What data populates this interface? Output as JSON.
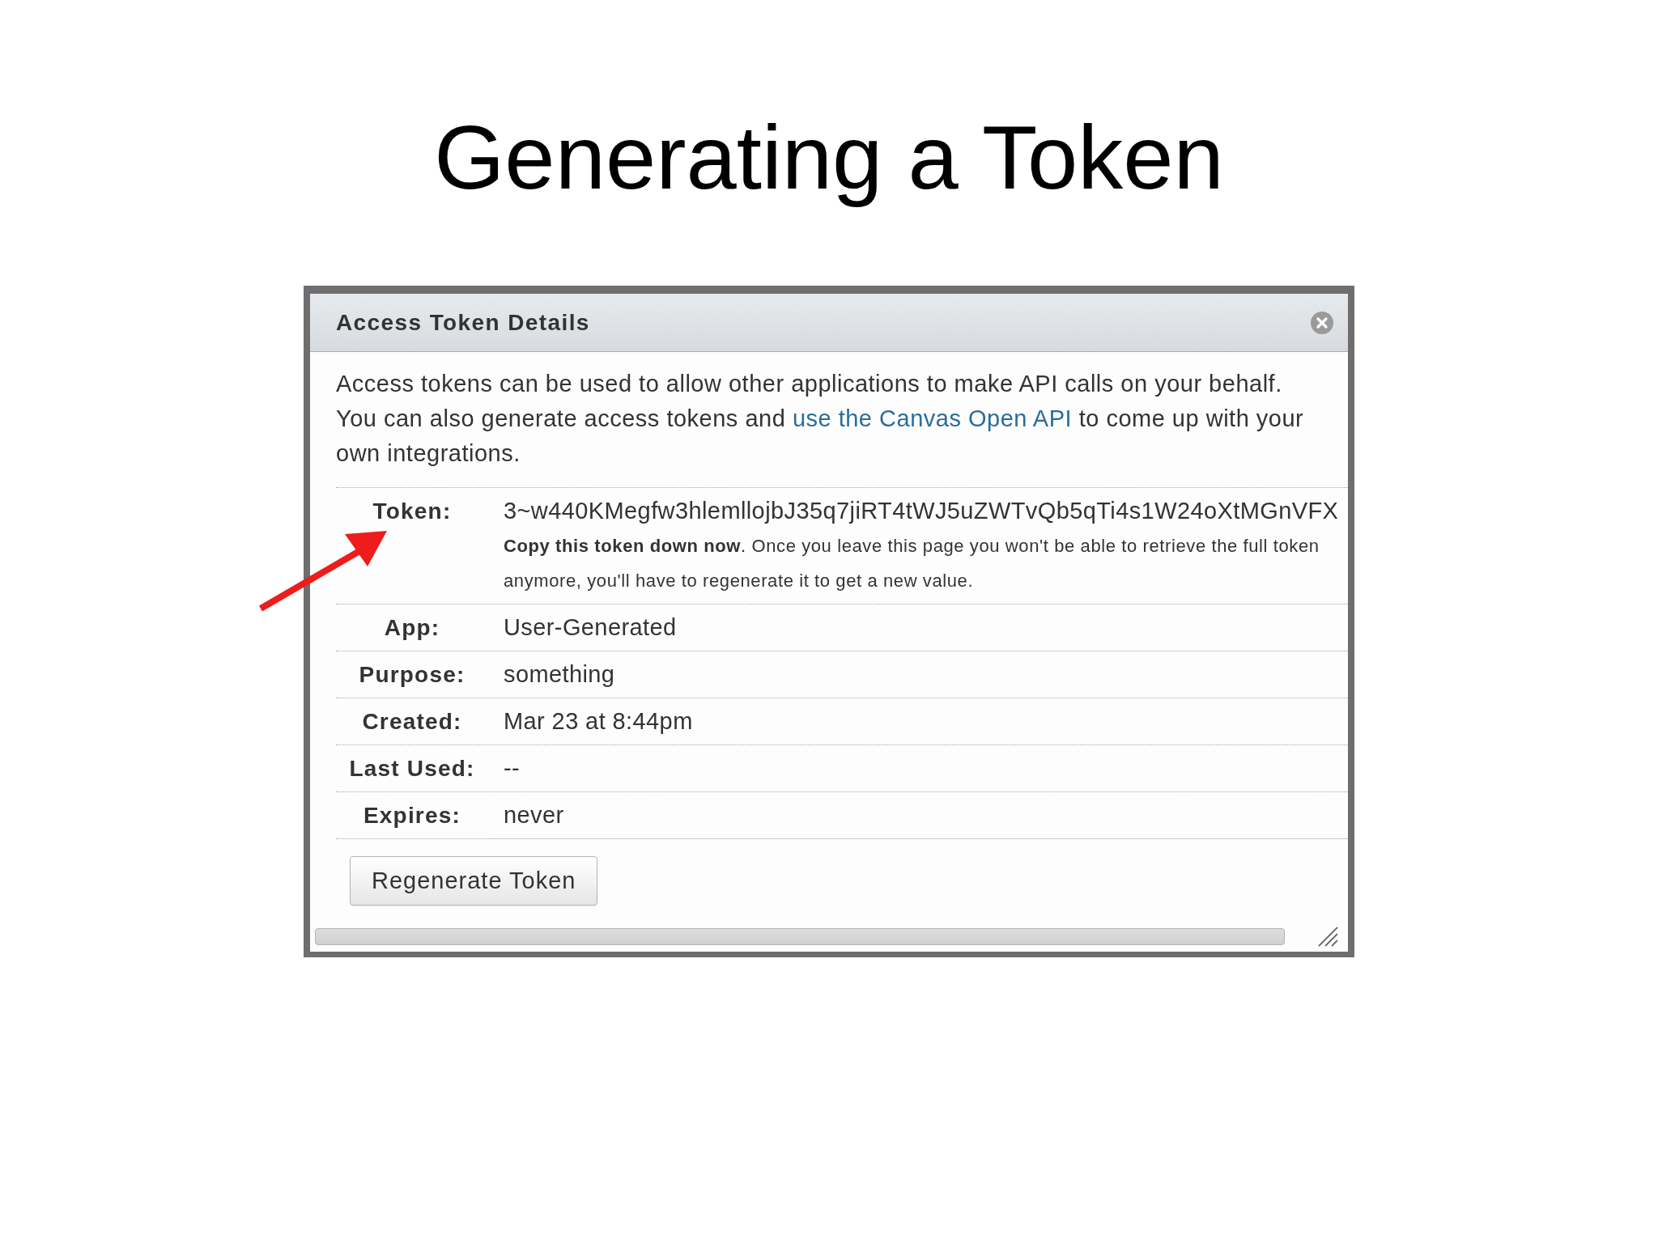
{
  "slide": {
    "title": "Generating a Token"
  },
  "dialog": {
    "title": "Access Token Details",
    "intro": [
      [
        {
          "kind": "text",
          "text": "Access tokens can be used to allow other applications to make API calls on your behalf."
        }
      ],
      [
        {
          "kind": "text",
          "text": "You can also generate access tokens and"
        },
        {
          "kind": "link",
          "text": "use the Canvas Open API"
        },
        {
          "kind": "text",
          "text": "to come up with your own integrations."
        }
      ]
    ],
    "details": [
      {
        "label": "Token:",
        "value": "3~w440KMegfw3hlemllojbJ35q7jiRT4tWJ5uZWTvQb5qTi4s1W24oXtMGnVFX",
        "note": "**Copy this token down now**. Once you leave this page you won't be able to retrieve the full token anymore, you'll have to regenerate it to get a new value."
      },
      {
        "label": "App:",
        "value": "User-Generated"
      },
      {
        "label": "Purpose:",
        "value": "something"
      },
      {
        "label": "Created:",
        "value": "Mar 23 at 8:44pm"
      },
      {
        "label": "Last Used:",
        "value": "--"
      },
      {
        "label": "Expires:",
        "value": "never"
      }
    ],
    "button": "Regenerate Token"
  },
  "callouts": [
    {
      "kind": "arrow"
    }
  ]
}
